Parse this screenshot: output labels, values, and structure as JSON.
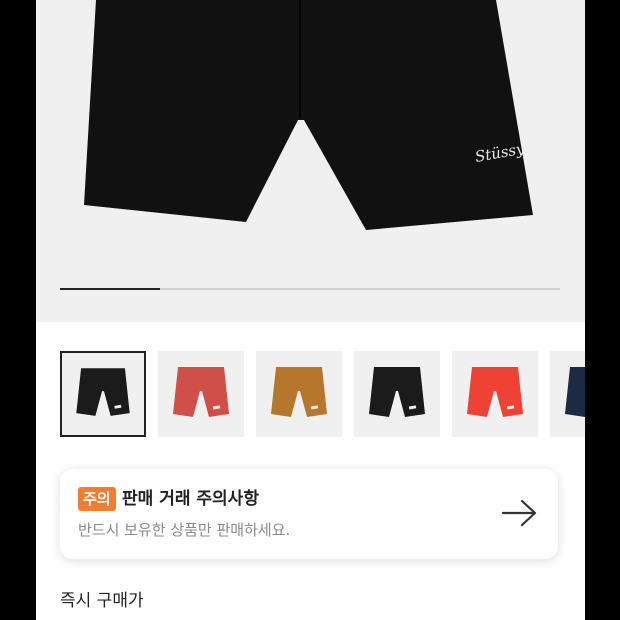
{
  "product": {
    "image_alt": "black shorts",
    "logo_text": "Stüssy"
  },
  "gallery": {
    "progress": 0.2,
    "thumbnails": [
      {
        "color": "#1b1b1b",
        "selected": true
      },
      {
        "color": "#cf5049",
        "selected": false
      },
      {
        "color": "#b6762b",
        "selected": false
      },
      {
        "color": "#1b1b1b",
        "selected": false
      },
      {
        "color": "#ee4334",
        "selected": false
      },
      {
        "color": "#1c2a44",
        "selected": false
      }
    ]
  },
  "notice": {
    "badge": "주의",
    "title": "판매 거래 주의사항",
    "subtitle": "반드시 보유한 상품만 판매하세요.",
    "icon": "arrow-right-icon"
  },
  "price": {
    "label": "즉시 구매가"
  },
  "colors": {
    "accent": "#f27d2e"
  }
}
